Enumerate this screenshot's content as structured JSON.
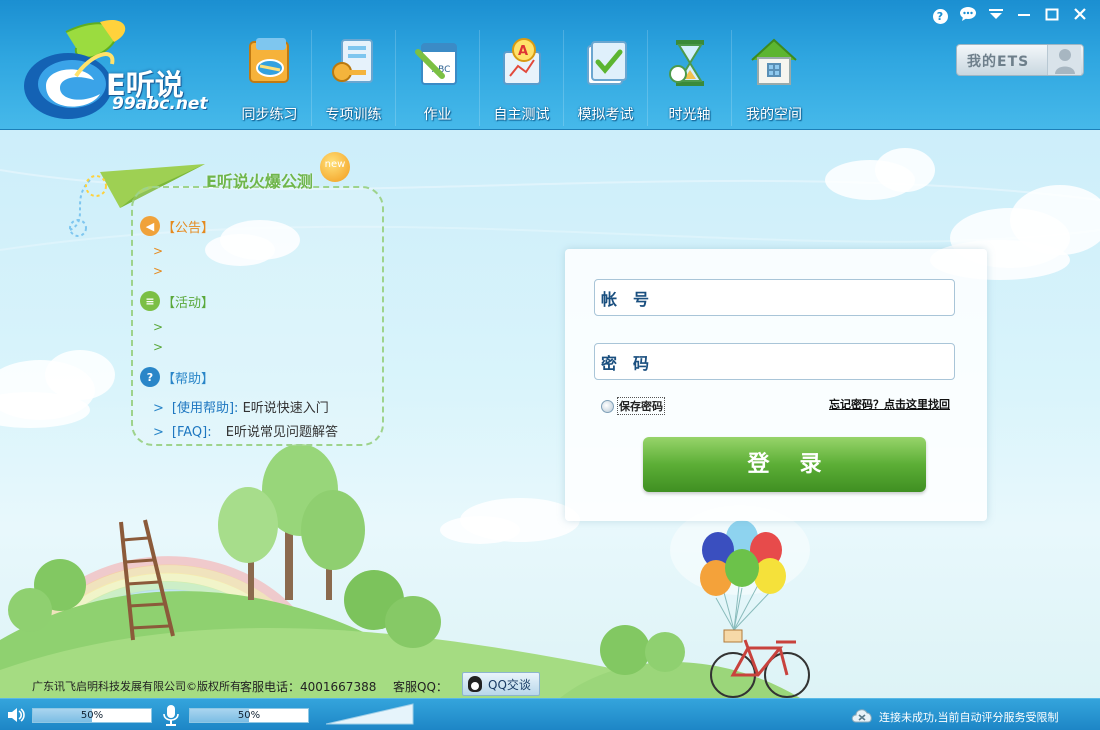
{
  "app": {
    "logo_text": "E听说",
    "logo_sub": "99abc.net"
  },
  "nav": [
    {
      "label": "同步练习",
      "icon": "sync-practice-icon"
    },
    {
      "label": "专项训练",
      "icon": "special-training-icon"
    },
    {
      "label": "作业",
      "icon": "homework-icon"
    },
    {
      "label": "自主测试",
      "icon": "self-test-icon"
    },
    {
      "label": "模拟考试",
      "icon": "mock-exam-icon"
    },
    {
      "label": "时光轴",
      "icon": "timeline-icon"
    },
    {
      "label": "我的空间",
      "icon": "my-space-icon"
    }
  ],
  "my_ets": {
    "label": "我的ETS"
  },
  "notice": {
    "title": "E听说火爆公测",
    "badge": "new",
    "announcement": {
      "label": "【公告】",
      "items": [
        ">",
        ">"
      ]
    },
    "activity": {
      "label": "【活动】",
      "items": [
        ">",
        ">"
      ]
    },
    "help": {
      "label": "【帮助】",
      "items": [
        {
          "tag": "[使用帮助]:",
          "text": "E听说快速入门"
        },
        {
          "tag": "[FAQ]:",
          "text": "E听说常见问题解答"
        }
      ]
    }
  },
  "login": {
    "account_label": "帐号",
    "password_label": "密码",
    "remember_label": "保存密码",
    "forgot_link": "忘记密码？点击这里找回",
    "submit_label": "登录"
  },
  "footer": {
    "copyright": "广东讯飞启明科技发展有限公司©版权所有",
    "hotline": "客服电话：4001667388",
    "qq_label": "客服QQ：",
    "qq_button": "QQ交谈"
  },
  "status": {
    "speaker_volume_text": "50%",
    "speaker_volume": 0.5,
    "mic_volume_text": "50%",
    "mic_volume": 0.5,
    "message": "连接未成功,当前自动评分服务受限制"
  },
  "colors": {
    "header": "#2fa6e0",
    "accent_green": "#5cae36",
    "announcement": "#e58a1f",
    "activity": "#6fb64c",
    "help": "#2a86c8"
  }
}
